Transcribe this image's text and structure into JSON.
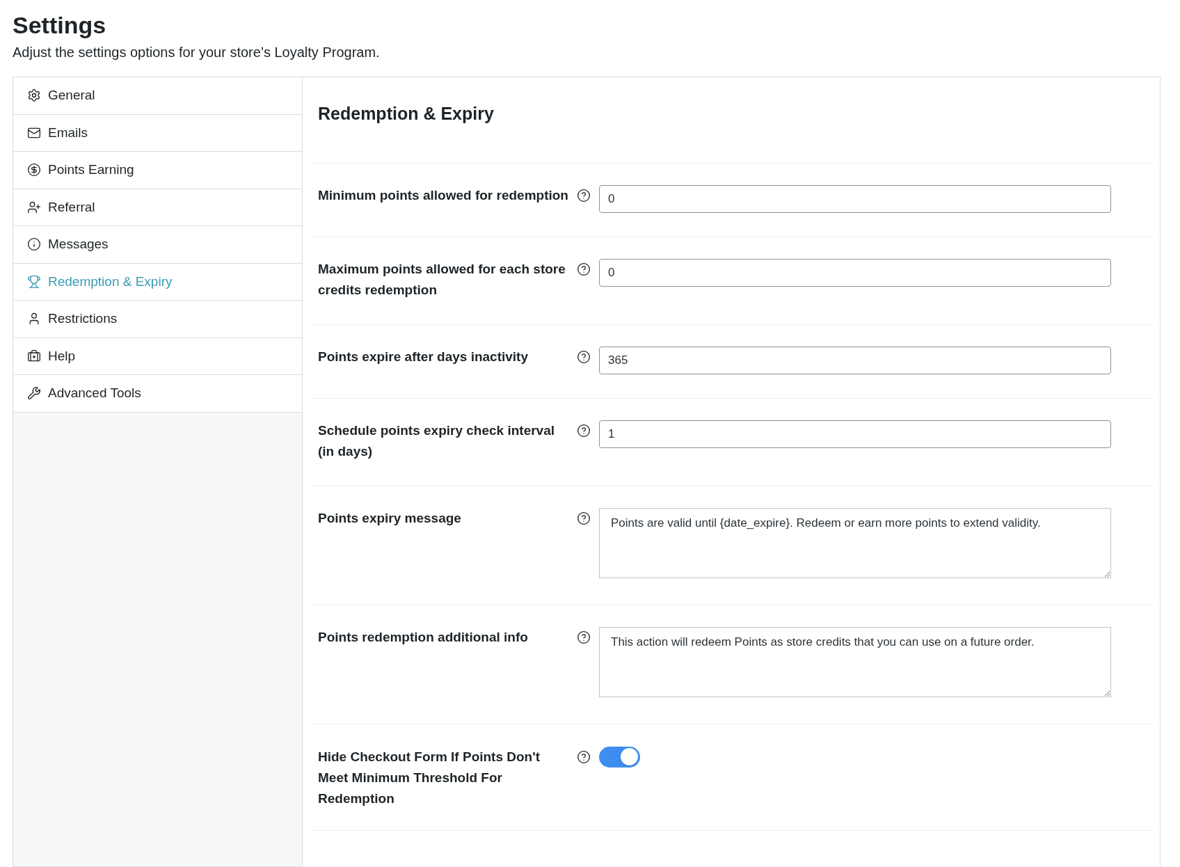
{
  "header": {
    "title": "Settings",
    "subtitle": "Adjust the settings options for your store’s Loyalty Program."
  },
  "sidebar": {
    "items": [
      {
        "label": "General",
        "selected": false
      },
      {
        "label": "Emails",
        "selected": false
      },
      {
        "label": "Points Earning",
        "selected": false
      },
      {
        "label": "Referral",
        "selected": false
      },
      {
        "label": "Messages",
        "selected": false
      },
      {
        "label": "Redemption & Expiry",
        "selected": true
      },
      {
        "label": "Restrictions",
        "selected": false
      },
      {
        "label": "Help",
        "selected": false
      },
      {
        "label": "Advanced Tools",
        "selected": false
      }
    ]
  },
  "panel": {
    "title": "Redemption & Expiry",
    "settings": [
      {
        "kind": "input",
        "label": "Minimum points allowed for redemption",
        "value": "0"
      },
      {
        "kind": "input",
        "label": "Maximum points allowed for each store credits redemption",
        "value": "0"
      },
      {
        "kind": "input",
        "label": "Points expire after days inactivity",
        "value": "365"
      },
      {
        "kind": "input",
        "label": "Schedule points expiry check interval (in days)",
        "value": "1"
      },
      {
        "kind": "textarea",
        "label": "Points expiry message",
        "value": "Points are valid until {date_expire}. Redeem or earn more points to extend validity."
      },
      {
        "kind": "textarea",
        "label": "Points redemption additional info",
        "value": "This action will redeem Points as store credits that you can use on a future order."
      },
      {
        "kind": "toggle",
        "label": "Hide Checkout Form If Points Don't Meet Minimum Threshold For Redemption",
        "on": true
      }
    ]
  }
}
